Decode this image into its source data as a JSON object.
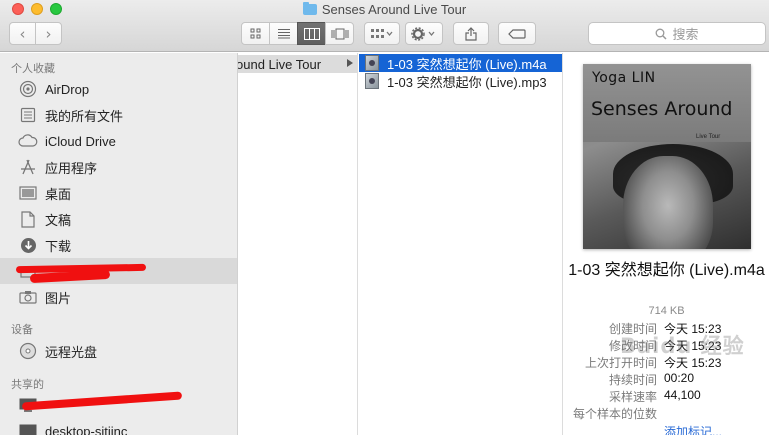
{
  "window": {
    "title": "Senses Around Live Tour"
  },
  "toolbar": {
    "back_icon": "chevron-left",
    "forward_icon": "chevron-right",
    "view_modes": [
      "icon-view",
      "list-view",
      "column-view",
      "cover-flow-view"
    ],
    "active_view": "column-view",
    "search_placeholder": "搜索",
    "accent": "#1564d5"
  },
  "sidebar": {
    "favorites_heading": "个人收藏",
    "favorites": [
      {
        "label": "AirDrop",
        "icon": "airdrop-icon"
      },
      {
        "label": "我的所有文件",
        "icon": "all-files-icon"
      },
      {
        "label": "iCloud Drive",
        "icon": "cloud-icon"
      },
      {
        "label": "应用程序",
        "icon": "applications-icon"
      },
      {
        "label": "桌面",
        "icon": "desktop-icon"
      },
      {
        "label": "文稿",
        "icon": "document-icon"
      },
      {
        "label": "下载",
        "icon": "download-icon"
      },
      {
        "label": "",
        "icon": "folder-icon",
        "selected": true
      },
      {
        "label": "图片",
        "icon": "camera-icon"
      }
    ],
    "devices_heading": "设备",
    "devices": [
      {
        "label": "远程光盘",
        "icon": "disc-icon"
      }
    ],
    "shared_heading": "共享的",
    "shared": [
      {
        "label": "",
        "icon": "computer-icon"
      },
      {
        "label": "desktop-sitiinc",
        "icon": "computer-icon"
      }
    ]
  },
  "columns": {
    "parent_folder": "Senses Around Live Tour",
    "parent_folder_visible": "ound Live Tour",
    "files": [
      {
        "name": "1-03 突然想起你 (Live).m4a",
        "selected": true
      },
      {
        "name": "1-03 突然想起你 (Live).mp3",
        "selected": false
      }
    ]
  },
  "preview": {
    "cover_artist": "Yoga LIN",
    "cover_album": "Senses Around",
    "cover_subtitle": "Live Tour",
    "title": "1-03 突然想起你 (Live).m4a",
    "size": "714 KB",
    "meta": [
      {
        "key": "创建时间",
        "value": "今天 15:23"
      },
      {
        "key": "修改时间",
        "value": "今天 15:23"
      },
      {
        "key": "上次打开时间",
        "value": "今天 15:23"
      },
      {
        "key": "持续时间",
        "value": "00:20"
      },
      {
        "key": "采样速率",
        "value": "44,100"
      },
      {
        "key": "每个样本的位数",
        "value": ""
      }
    ],
    "add_tags": "添加标记..."
  },
  "watermark": "Baidu 经验"
}
